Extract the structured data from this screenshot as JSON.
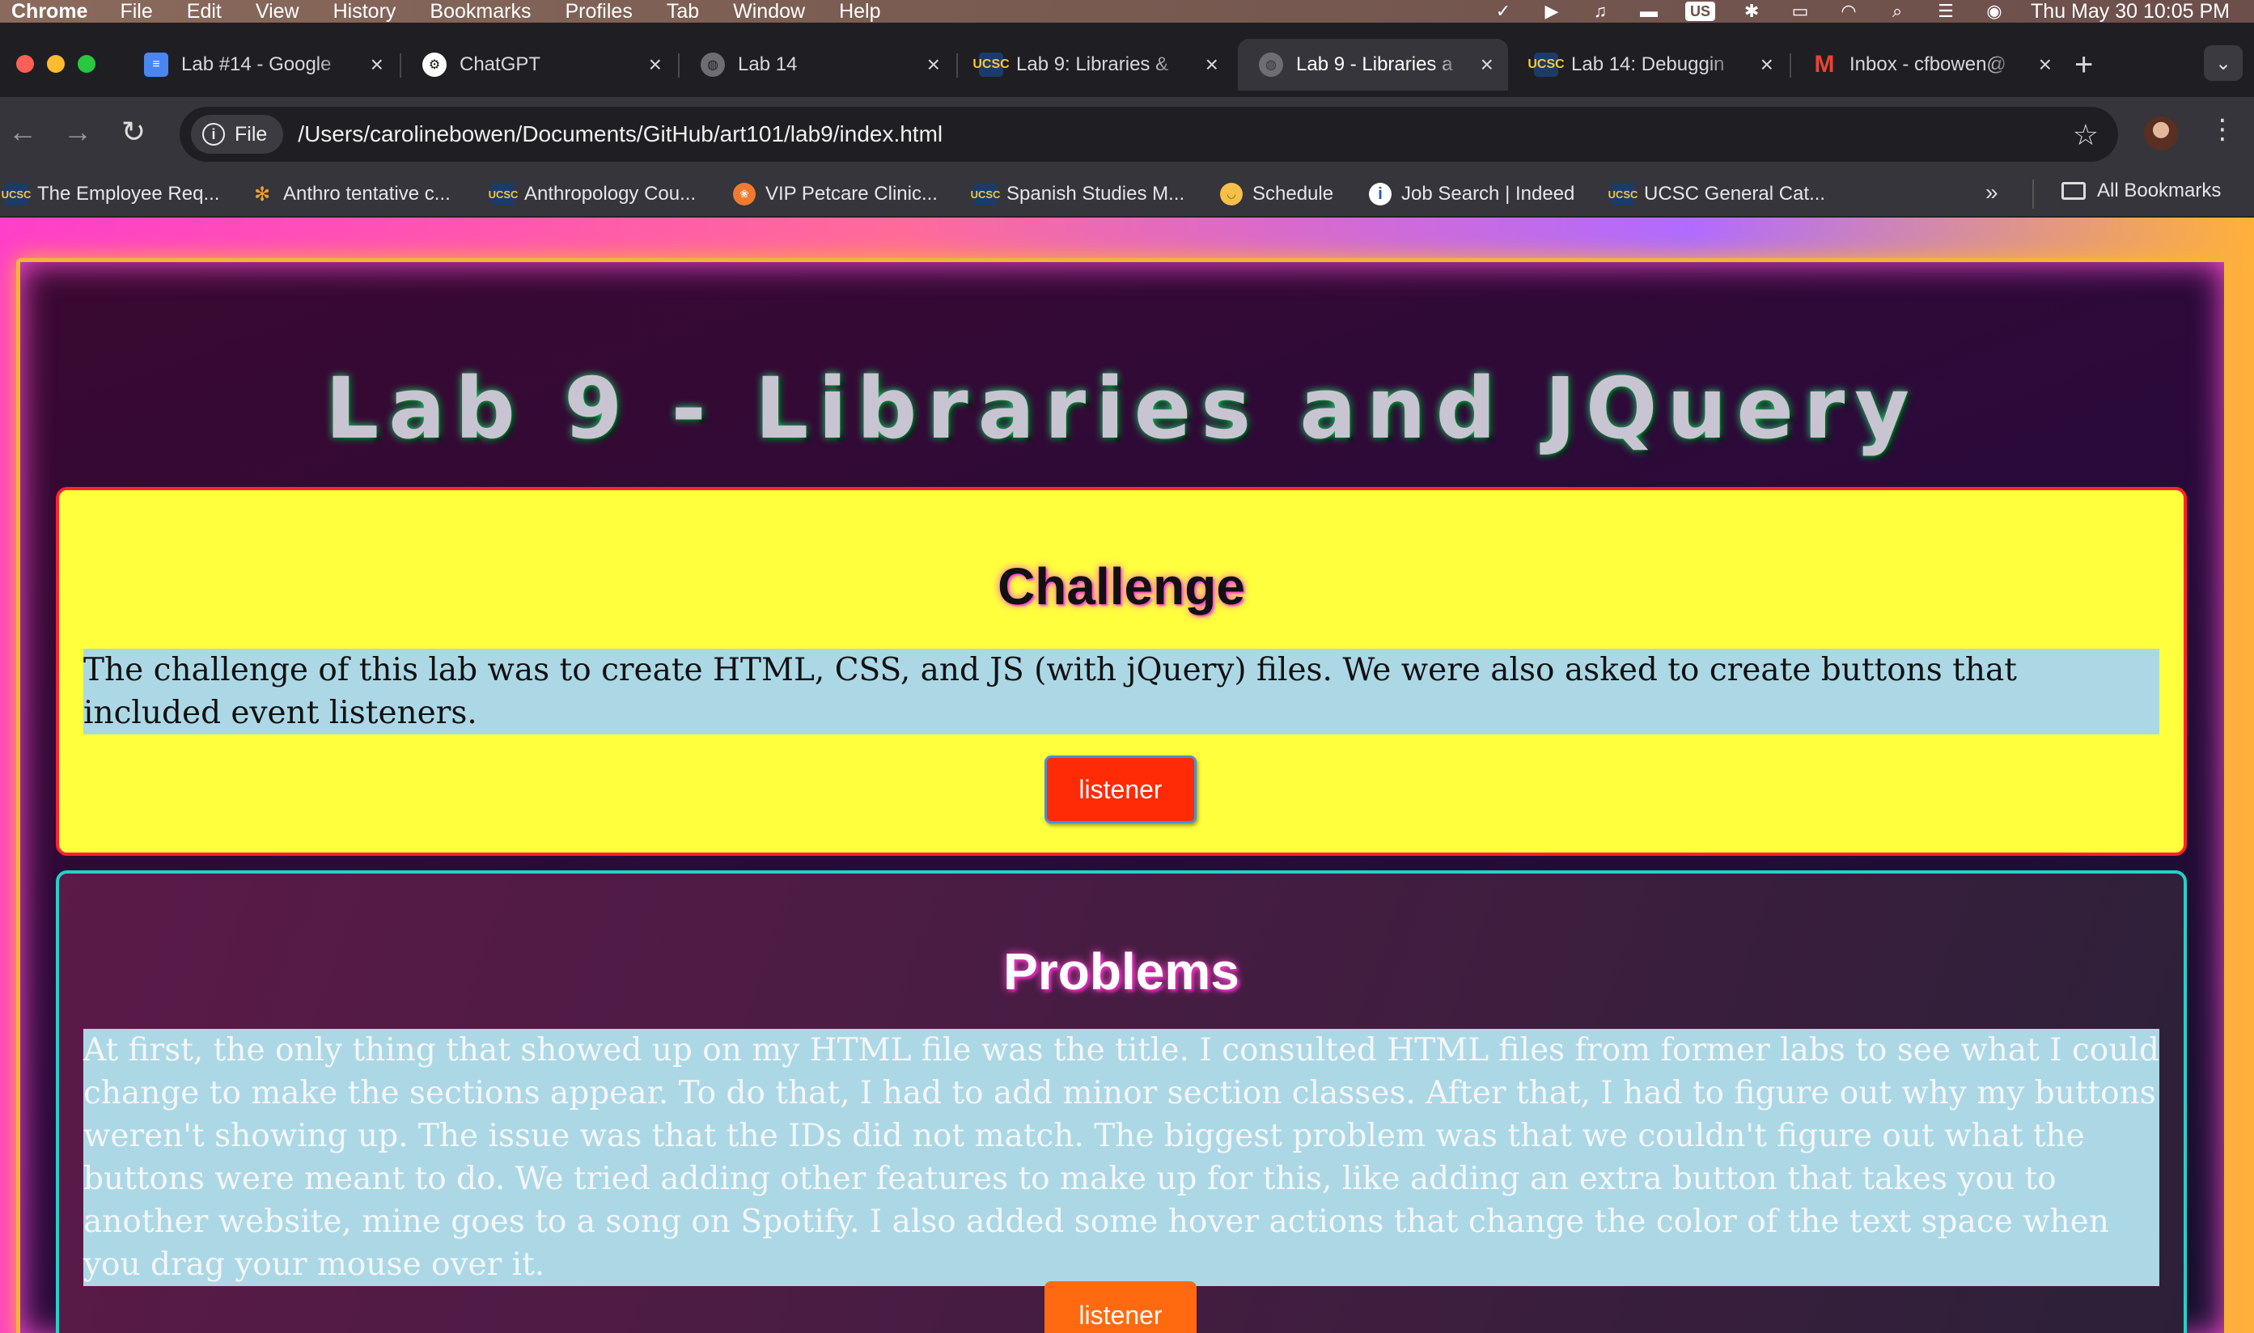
{
  "menubar": {
    "app": "Chrome",
    "items": [
      "File",
      "Edit",
      "View",
      "History",
      "Bookmarks",
      "Profiles",
      "Tab",
      "Window",
      "Help"
    ],
    "input_source": "US",
    "clock": "Thu May 30  10:05 PM"
  },
  "tabs": [
    {
      "title": "Lab #14 - Google",
      "favicon": "google-docs-icon",
      "color": "#4a86f0"
    },
    {
      "title": "ChatGPT",
      "favicon": "chatgpt-icon",
      "color": "#ffffff"
    },
    {
      "title": "Lab 14",
      "favicon": "globe-icon",
      "color": "#8a8a90"
    },
    {
      "title": "Lab 9: Libraries &",
      "favicon": "ucsc-icon",
      "color": "#e8b82e"
    },
    {
      "title": "Lab 9 - Libraries a",
      "favicon": "globe-icon",
      "color": "#8a8a90",
      "active": true
    },
    {
      "title": "Lab 14: Debuggin",
      "favicon": "ucsc-icon",
      "color": "#e8b82e"
    },
    {
      "title": "Inbox - cfbowen@",
      "favicon": "gmail-icon",
      "color": "#ea4335"
    }
  ],
  "toolbar": {
    "chip_label": "File",
    "url": "/Users/carolinebowen/Documents/GitHub/art101/lab9/index.html"
  },
  "bookmarks": [
    {
      "label": "The Employee Req...",
      "icon": "ucsc-icon"
    },
    {
      "label": "Anthro tentative c...",
      "icon": "pinwheel-icon"
    },
    {
      "label": "Anthropology Cou...",
      "icon": "ucsc-icon"
    },
    {
      "label": "VIP Petcare Clinic...",
      "icon": "paw-icon"
    },
    {
      "label": "Spanish Studies M...",
      "icon": "ucsc-icon"
    },
    {
      "label": "Schedule",
      "icon": "smile-icon"
    },
    {
      "label": "Job Search | Indeed",
      "icon": "indeed-icon"
    },
    {
      "label": "UCSC General Cat...",
      "icon": "ucsc-icon"
    }
  ],
  "bookmarks_all": "All Bookmarks",
  "page": {
    "title": "Lab 9 - Libraries and JQuery",
    "challenge": {
      "heading": "Challenge",
      "text": "The challenge of this lab was to create HTML, CSS, and JS (with jQuery) files. We were also asked to create buttons that included event listeners.",
      "button": "listener"
    },
    "problems": {
      "heading": "Problems",
      "text": "At first, the only thing that showed up on my HTML file was the title. I consulted HTML files from former labs to see what I could change to make the sections appear. To do that, I had to add minor section classes. After that, I had to figure out why my buttons weren't showing up. The issue was that the IDs did not match. The biggest problem was that we couldn't figure out what the buttons were meant to do. We tried adding other features to make up for this, like adding an extra button that takes you to another website, mine goes to a song on Spotify. I also added some hover actions that change the color of the text space when you drag your mouse over it.",
      "button": "listener"
    }
  }
}
